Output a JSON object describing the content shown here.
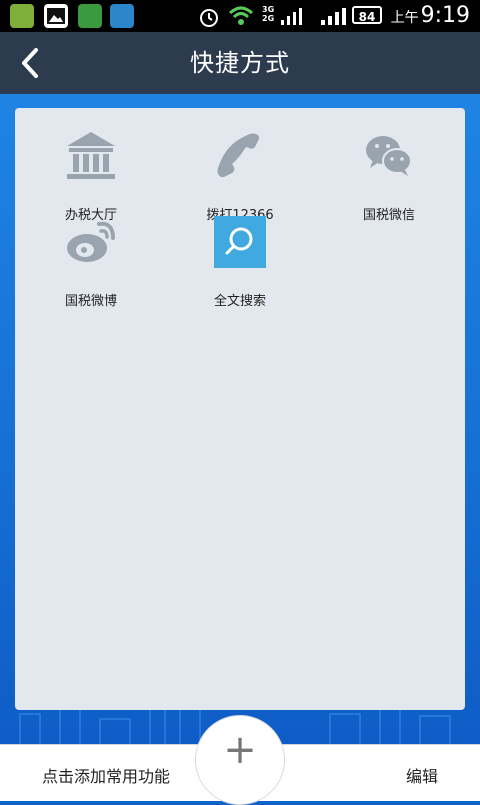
{
  "status_bar": {
    "network_top": "3G",
    "network_bottom": "2G",
    "battery": "84",
    "ampm": "上午",
    "time": "9:19"
  },
  "header": {
    "title": "快捷方式"
  },
  "shortcuts": [
    {
      "label": "办税大厅",
      "icon": "bank-icon"
    },
    {
      "label": "拨打12366",
      "icon": "phone-icon"
    },
    {
      "label": "国税微信",
      "icon": "wechat-icon"
    },
    {
      "label": "国税微博",
      "icon": "weibo-icon"
    },
    {
      "label": "全文搜索",
      "icon": "search-icon"
    }
  ],
  "bottom": {
    "add_hint": "点击添加常用功能",
    "edit_label": "编辑",
    "add_icon": "plus-icon"
  },
  "colors": {
    "header": "#2d3b4e",
    "background": "#1670d6",
    "panel": "#e3e8ef",
    "icon_gray": "#9aa4ae",
    "search_tile": "#3fa9e0"
  }
}
